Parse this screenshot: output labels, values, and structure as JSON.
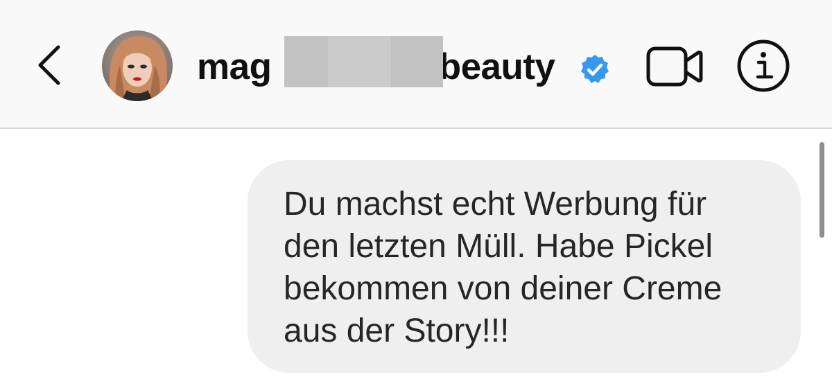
{
  "header": {
    "username_prefix": "mag",
    "username_suffix": ".beauty",
    "back_icon": "chevron-left-icon",
    "verified_icon": "verified-badge-icon",
    "video_icon": "video-camera-icon",
    "info_icon": "info-icon"
  },
  "message": {
    "text": "Du machst echt Werbung für\nden letzten Müll. Habe Pickel\nbekommen von deiner Creme\naus der Story!!!"
  },
  "colors": {
    "header_bg": "#f9f9f9",
    "bubble_bg": "#efefef",
    "verified_blue": "#3897f0",
    "text": "#262626"
  }
}
